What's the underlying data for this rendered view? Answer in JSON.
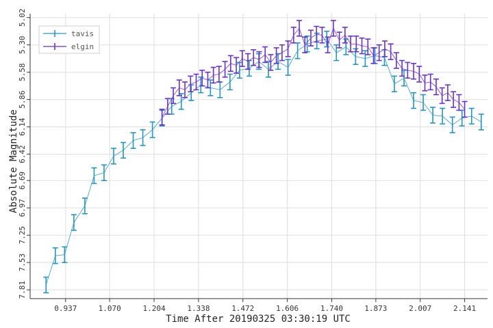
{
  "chart_data": {
    "type": "scatter",
    "xlabel": "Time After 20190325 03:30:19 UTC",
    "ylabel": "Absolute Magnitude",
    "x_ticks": [
      "0.937",
      "1.070",
      "1.204",
      "1.338",
      "1.472",
      "1.606",
      "1.740",
      "1.873",
      "2.007",
      "2.141"
    ],
    "y_ticks": [
      "5.02",
      "5.30",
      "5.58",
      "5.86",
      "6.14",
      "6.42",
      "6.69",
      "6.97",
      "7.25",
      "7.53",
      "7.81"
    ],
    "xlim": [
      0.83,
      2.21
    ],
    "ylim": [
      7.9,
      4.98
    ],
    "y_inverted": true,
    "grid": true,
    "legend_position": "top-left",
    "series": [
      {
        "name": "tavis",
        "color": "#1f96c8",
        "error": 0.08,
        "x": [
          0.878,
          0.906,
          0.934,
          0.962,
          0.995,
          1.023,
          1.053,
          1.082,
          1.111,
          1.141,
          1.17,
          1.199,
          1.228,
          1.257,
          1.286,
          1.316,
          1.345,
          1.374,
          1.403,
          1.433,
          1.462,
          1.491,
          1.52,
          1.549,
          1.578,
          1.608,
          1.637,
          1.666,
          1.695,
          1.725,
          1.754,
          1.783,
          1.812,
          1.841,
          1.87,
          1.899,
          1.929,
          1.958,
          1.987,
          2.016,
          2.045,
          2.074,
          2.104,
          2.133,
          2.162,
          2.191
        ],
        "y": [
          7.76,
          7.46,
          7.45,
          7.12,
          6.95,
          6.64,
          6.61,
          6.44,
          6.38,
          6.28,
          6.25,
          6.17,
          6.05,
          5.93,
          5.88,
          5.79,
          5.71,
          5.74,
          5.76,
          5.68,
          5.56,
          5.54,
          5.47,
          5.55,
          5.47,
          5.53,
          5.36,
          5.29,
          5.26,
          5.24,
          5.38,
          5.32,
          5.42,
          5.44,
          5.41,
          5.43,
          5.7,
          5.64,
          5.87,
          5.89,
          6.02,
          6.03,
          6.12,
          6.05,
          6.03,
          6.09
        ]
      },
      {
        "name": "elgin",
        "color": "#6a2fd4",
        "error": 0.08,
        "x": [
          1.228,
          1.245,
          1.262,
          1.28,
          1.297,
          1.314,
          1.331,
          1.349,
          1.366,
          1.383,
          1.4,
          1.418,
          1.435,
          1.452,
          1.47,
          1.487,
          1.504,
          1.521,
          1.539,
          1.556,
          1.573,
          1.59,
          1.608,
          1.625,
          1.642,
          1.659,
          1.677,
          1.694,
          1.711,
          1.728,
          1.745,
          1.763,
          1.78,
          1.797,
          1.814,
          1.831,
          1.849,
          1.866,
          1.883,
          1.9,
          1.918,
          1.935,
          1.952,
          1.969,
          1.987,
          2.004,
          2.021,
          2.038,
          2.055,
          2.073,
          2.09,
          2.107,
          2.124,
          2.141
        ],
        "y": [
          6.04,
          5.93,
          5.82,
          5.74,
          5.76,
          5.7,
          5.68,
          5.64,
          5.66,
          5.61,
          5.6,
          5.55,
          5.49,
          5.51,
          5.44,
          5.47,
          5.43,
          5.45,
          5.4,
          5.48,
          5.41,
          5.38,
          5.34,
          5.2,
          5.13,
          5.3,
          5.23,
          5.19,
          5.2,
          5.3,
          5.13,
          5.25,
          5.2,
          5.29,
          5.29,
          5.31,
          5.32,
          5.41,
          5.38,
          5.34,
          5.37,
          5.46,
          5.54,
          5.56,
          5.57,
          5.6,
          5.69,
          5.68,
          5.73,
          5.82,
          5.79,
          5.86,
          5.89,
          5.96
        ]
      }
    ]
  }
}
